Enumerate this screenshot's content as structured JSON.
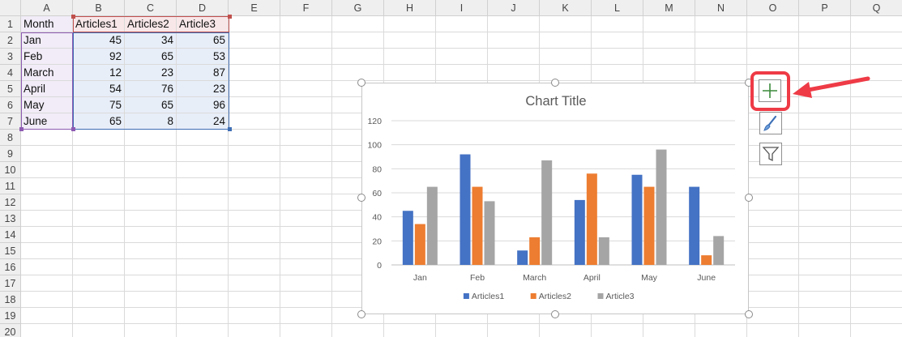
{
  "sheet": {
    "columns": [
      "A",
      "B",
      "C",
      "D",
      "E",
      "F",
      "G",
      "H",
      "I",
      "J",
      "K",
      "L",
      "M",
      "N",
      "O",
      "P",
      "Q"
    ],
    "rows": [
      "1",
      "2",
      "3",
      "4",
      "5",
      "6",
      "7",
      "8",
      "9",
      "10",
      "11",
      "12",
      "13",
      "14",
      "15",
      "16",
      "17",
      "18",
      "19",
      "20"
    ],
    "table": {
      "headers": [
        "Month",
        "Articles1",
        "Articles2",
        "Article3"
      ],
      "rows": [
        [
          "Jan",
          "45",
          "34",
          "65"
        ],
        [
          "Feb",
          "92",
          "65",
          "53"
        ],
        [
          "March",
          "12",
          "23",
          "87"
        ],
        [
          "April",
          "54",
          "76",
          "23"
        ],
        [
          "May",
          "75",
          "65",
          "96"
        ],
        [
          "June",
          "65",
          "8",
          "24"
        ]
      ]
    }
  },
  "chart_data": {
    "type": "bar",
    "title": "Chart Title",
    "categories": [
      "Jan",
      "Feb",
      "March",
      "April",
      "May",
      "June"
    ],
    "series": [
      {
        "name": "Articles1",
        "values": [
          45,
          92,
          12,
          54,
          75,
          65
        ],
        "color": "#4472c4"
      },
      {
        "name": "Articles2",
        "values": [
          34,
          65,
          23,
          76,
          65,
          8
        ],
        "color": "#ed7d31"
      },
      {
        "name": "Article3",
        "values": [
          65,
          53,
          87,
          23,
          96,
          24
        ],
        "color": "#a5a5a5"
      }
    ],
    "ylim": [
      0,
      120
    ],
    "yticks": [
      "0",
      "20",
      "40",
      "60",
      "80",
      "100",
      "120"
    ],
    "grid": true,
    "legend": "bottom"
  },
  "chart_tools": {
    "plus": "chart-elements",
    "brush": "chart-styles",
    "filter": "chart-filters"
  },
  "colors": {
    "highlight": "#ee3b46",
    "header_select": "#f8e7e9",
    "body_select": "#e8eef8"
  }
}
